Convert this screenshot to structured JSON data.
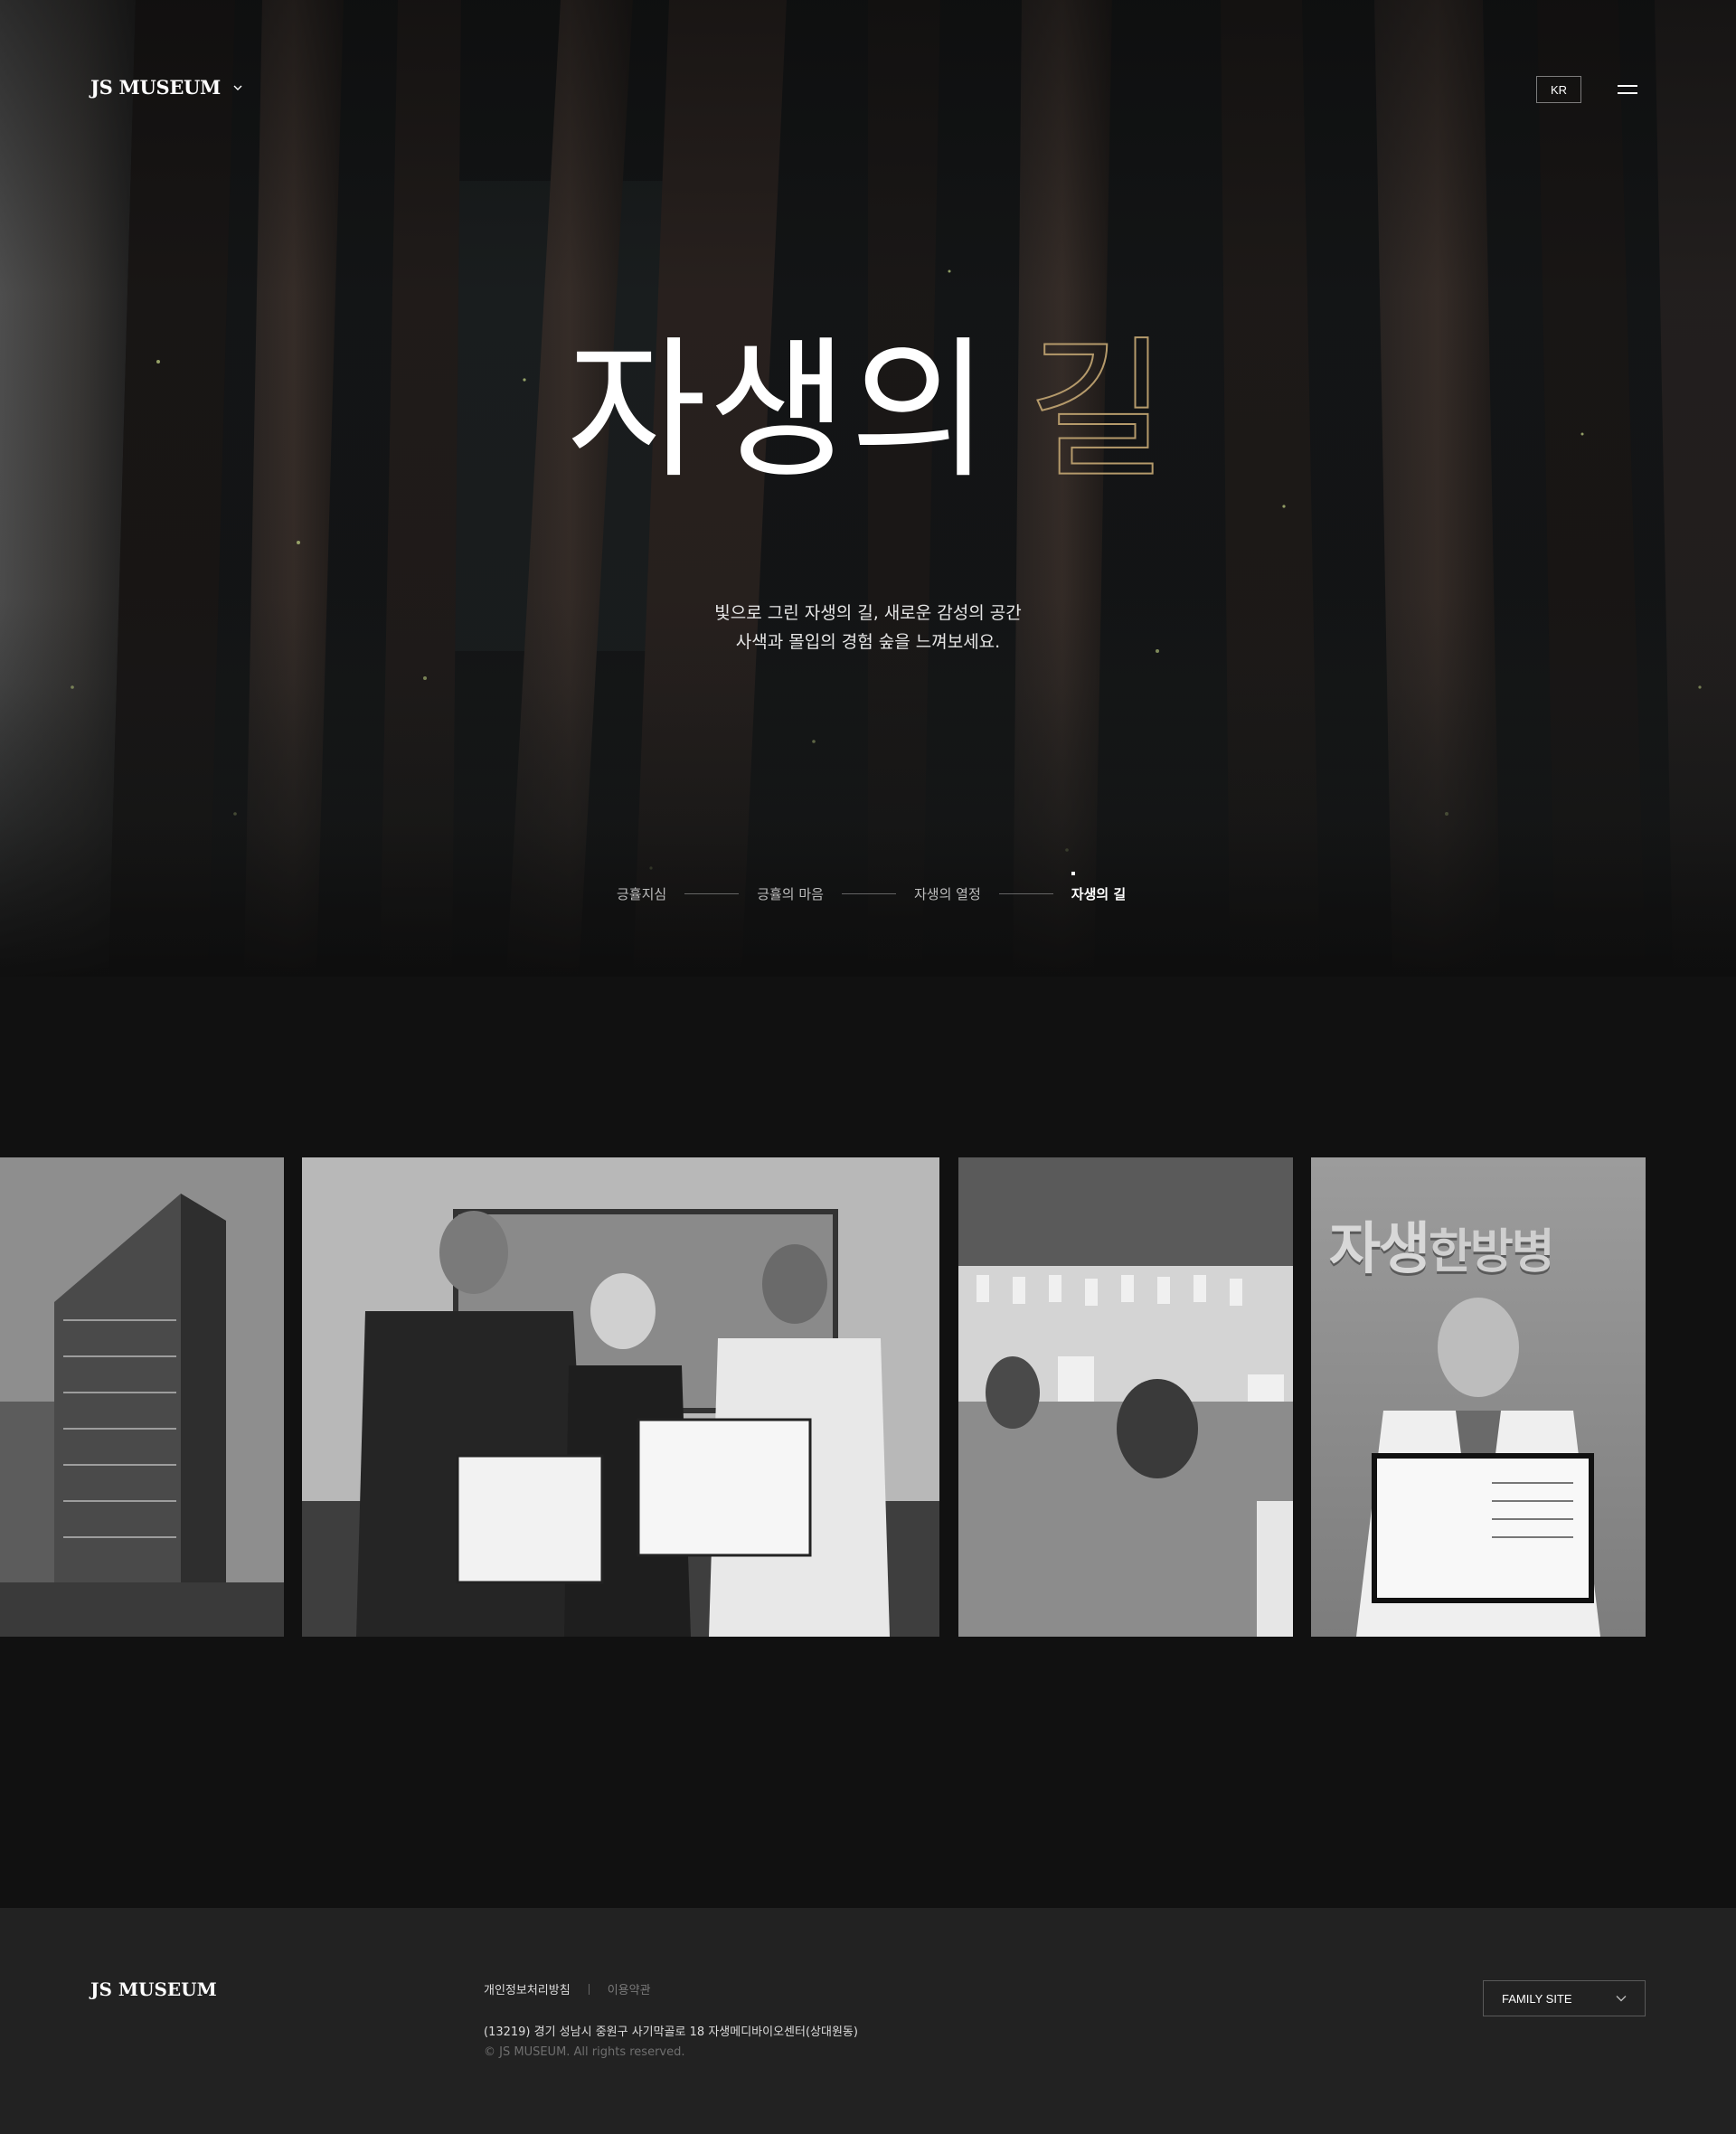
{
  "header": {
    "logo": "JS MUSEUM",
    "language": "KR",
    "menu_icon": "hamburger-icon"
  },
  "hero": {
    "title_main": "자생의",
    "title_accent": "길",
    "subtitle_line1": "빛으로 그린 자생의 길, 새로운 감성의 공간",
    "subtitle_line2": "사색과 몰입의 경험 숲을 느껴보세요.",
    "accent_color": "#b59a6b"
  },
  "steps": [
    {
      "label": "긍휼지심",
      "active": false
    },
    {
      "label": "긍휼의 마음",
      "active": false
    },
    {
      "label": "자생의 열정",
      "active": false
    },
    {
      "label": "자생의 길",
      "active": true
    }
  ],
  "gallery": {
    "sign_text_main": "자생",
    "sign_text_rest": "한방병"
  },
  "footer": {
    "logo": "JS MUSEUM",
    "privacy_link": "개인정보처리방침",
    "terms_link": "이용약관",
    "address": "(13219) 경기 성남시 중원구 사기막골로 18 자생메디바이오센터(상대원동)",
    "copyright": "© JS MUSEUM. All rights reserved.",
    "family_site": "FAMILY SITE"
  }
}
